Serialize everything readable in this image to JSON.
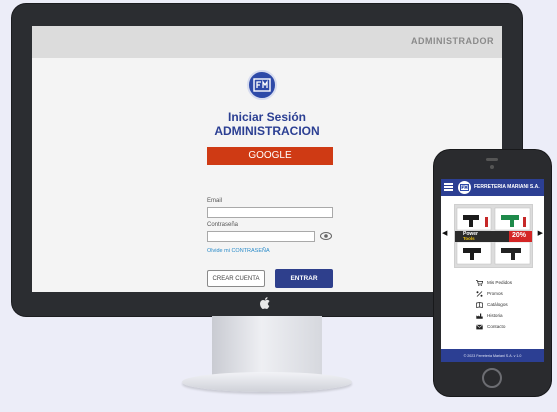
{
  "desktop": {
    "topbar_title": "ADMINISTRADOR",
    "login": {
      "heading_line1": "Iniciar Sesión",
      "heading_line2": "ADMINISTRACION",
      "google_label": "GOOGLE",
      "email_label": "Email",
      "email_value": "",
      "password_label": "Contraseña",
      "password_value": "",
      "forgot_link": "Olvide mi CONTRASEÑA",
      "create_account_label": "CREAR CUENTA",
      "enter_label": "ENTRAR"
    },
    "colors": {
      "accent": "#2e3f8c",
      "google": "#cf3a14",
      "heading": "#2b3f93",
      "link": "#2a8bc9"
    }
  },
  "mobile": {
    "brand": "FERRETERIA MARIANI S.A.",
    "banner": {
      "line1": "Power",
      "line2": "Tools",
      "discount": "20%"
    },
    "menu_items": [
      {
        "label": "Mis Pedidos",
        "icon": "cart-icon"
      },
      {
        "label": "Promos",
        "icon": "percent-icon"
      },
      {
        "label": "Catálogos",
        "icon": "book-icon"
      },
      {
        "label": "Historia",
        "icon": "factory-icon"
      },
      {
        "label": "Contacto",
        "icon": "mail-icon"
      }
    ],
    "footer": "© 2023 Ferretería Mariani S.A. v 1.0"
  }
}
